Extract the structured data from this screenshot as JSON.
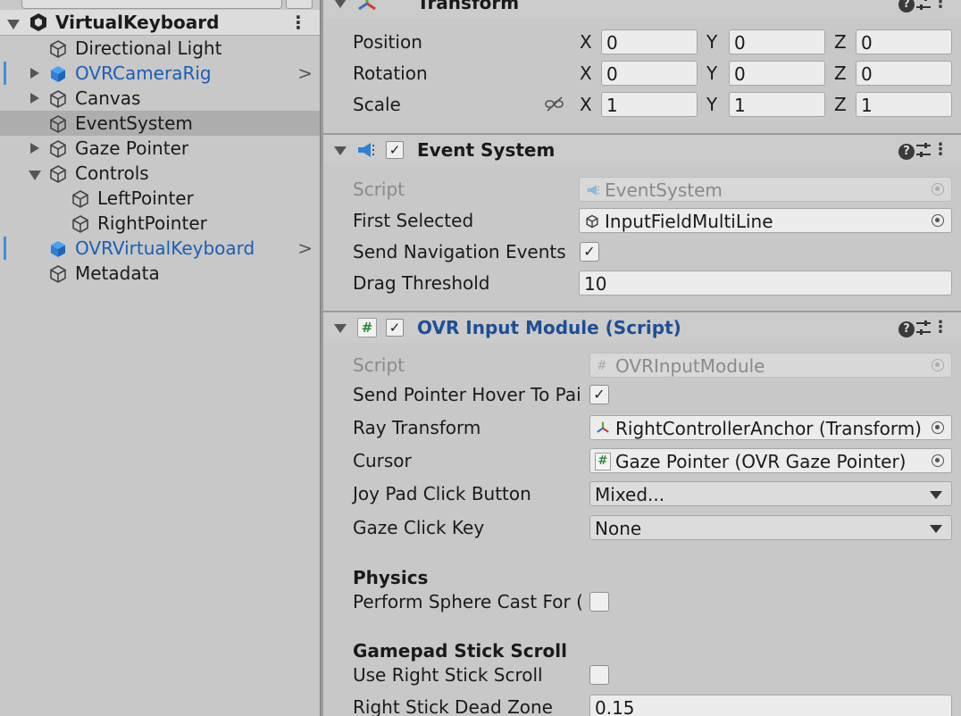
{
  "hierarchy": {
    "scene_name": "VirtualKeyboard",
    "items": [
      {
        "label": "Directional Light"
      },
      {
        "label": "OVRCameraRig"
      },
      {
        "label": "Canvas"
      },
      {
        "label": "EventSystem"
      },
      {
        "label": "Gaze Pointer"
      },
      {
        "label": "Controls"
      },
      {
        "label": "LeftPointer"
      },
      {
        "label": "RightPointer"
      },
      {
        "label": "OVRVirtualKeyboard"
      },
      {
        "label": "Metadata"
      }
    ],
    "chevron": ">",
    "kebab": "⋮"
  },
  "transform": {
    "title": "Transform",
    "position_label": "Position",
    "rotation_label": "Rotation",
    "scale_label": "Scale",
    "x": "X",
    "y": "Y",
    "z": "Z",
    "position": [
      "0",
      "0",
      "0"
    ],
    "rotation": [
      "0",
      "0",
      "0"
    ],
    "scale": [
      "1",
      "1",
      "1"
    ]
  },
  "event_system": {
    "title": "Event System",
    "script_label": "Script",
    "script_value": "EventSystem",
    "first_selected_label": "First Selected",
    "first_selected_value": "InputFieldMultiLine",
    "send_nav_label": "Send Navigation Events",
    "send_nav_checked": true,
    "drag_threshold_label": "Drag Threshold",
    "drag_threshold_value": "10"
  },
  "ovr_input": {
    "title": "OVR Input Module (Script)",
    "script_label": "Script",
    "script_value": "OVRInputModule",
    "hover_label": "Send Pointer Hover To Pai",
    "hover_checked": true,
    "ray_label": "Ray Transform",
    "ray_value": "RightControllerAnchor (Transform)",
    "cursor_label": "Cursor",
    "cursor_value": "Gaze Pointer (OVR Gaze Pointer)",
    "joypad_label": "Joy Pad Click Button",
    "joypad_value": "Mixed...",
    "gaze_key_label": "Gaze Click Key",
    "gaze_key_value": "None",
    "physics_header": "Physics",
    "sphere_label": "Perform Sphere Cast For (",
    "sphere_checked": false,
    "gamepad_header": "Gamepad Stick Scroll",
    "right_stick_label": "Use Right Stick Scroll",
    "right_stick_checked": false,
    "dead_zone_label": "Right Stick Dead Zone",
    "dead_zone_value": "0.15"
  },
  "check_glyph": "✓",
  "hash_glyph": "#",
  "help_glyph": "?"
}
